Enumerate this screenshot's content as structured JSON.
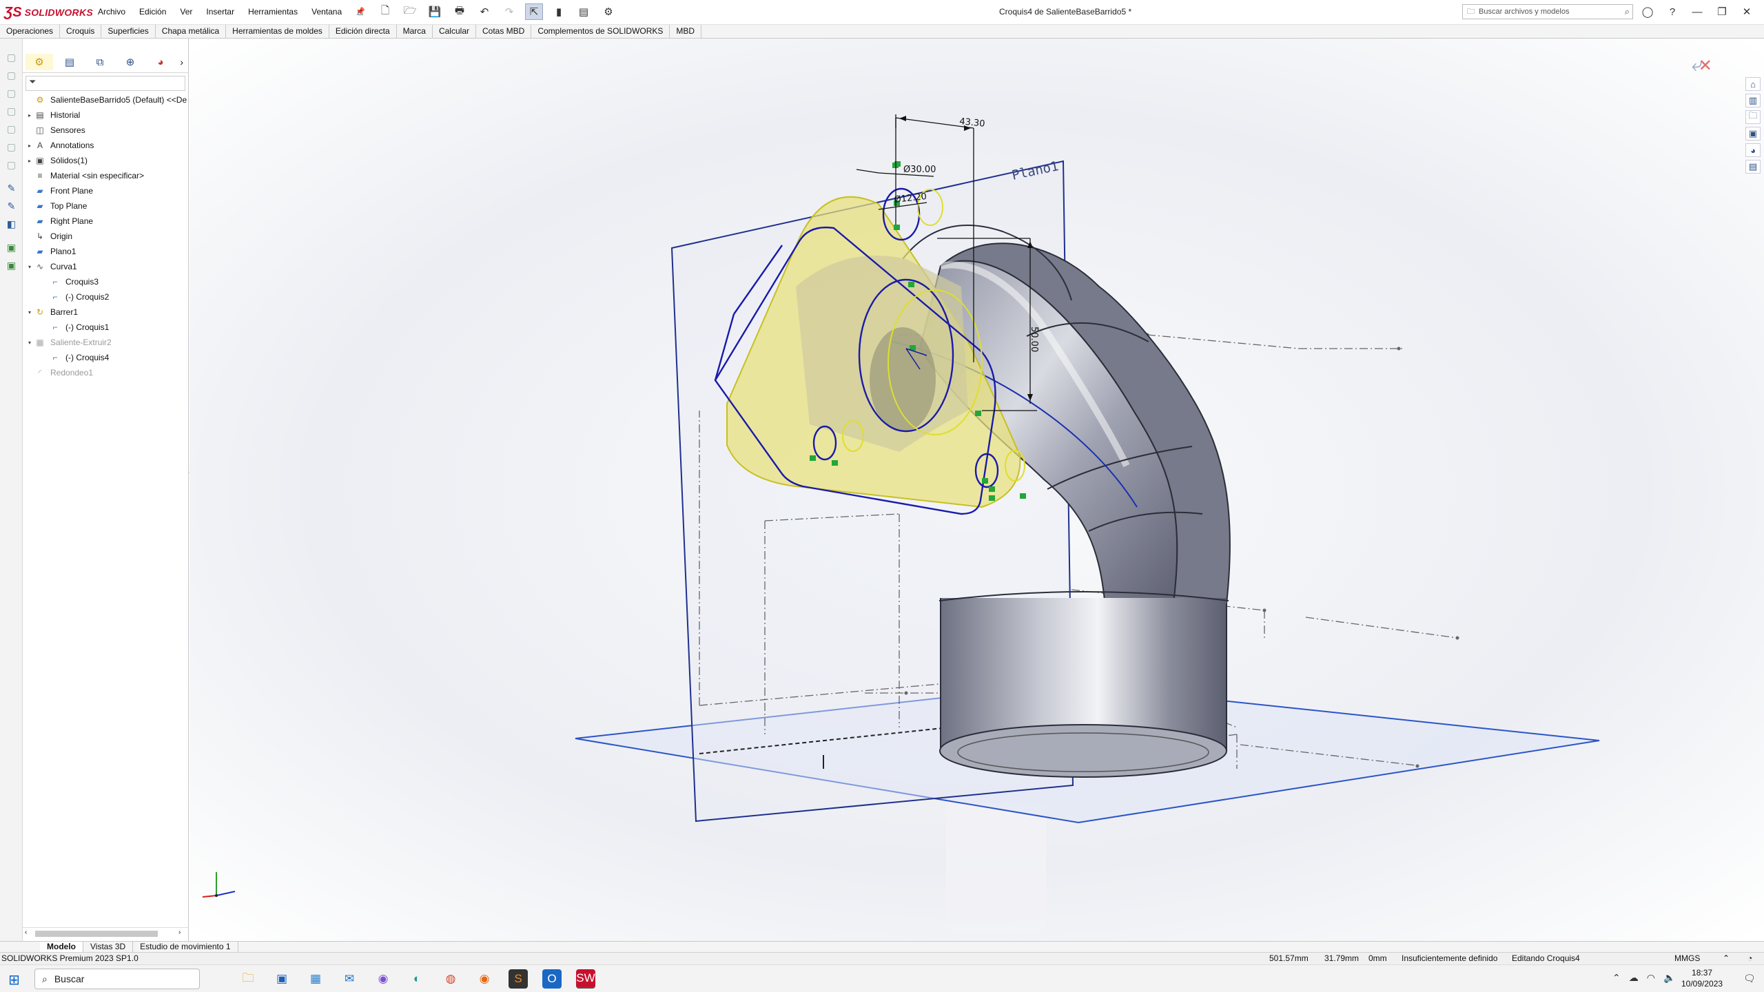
{
  "app": {
    "brand": "SOLIDWORKS",
    "document_title": "Croquis4 de SalienteBaseBarrido5 *"
  },
  "menu": {
    "items": [
      "Archivo",
      "Edición",
      "Ver",
      "Insertar",
      "Herramientas",
      "Ventana"
    ]
  },
  "search": {
    "placeholder": "Buscar archivos y modelos"
  },
  "command_tabs": [
    "Operaciones",
    "Croquis",
    "Superficies",
    "Chapa metálica",
    "Herramientas de moldes",
    "Edición directa",
    "Marca",
    "Calcular",
    "Cotas MBD",
    "Complementos de SOLIDWORKS",
    "MBD"
  ],
  "feature_tree": [
    {
      "label": "SalienteBaseBarrido5 (Default) <<De",
      "indent": 0,
      "expand": "",
      "icon": "part-icon"
    },
    {
      "label": "Historial",
      "indent": 0,
      "expand": "▸",
      "icon": "history-icon"
    },
    {
      "label": "Sensores",
      "indent": 0,
      "expand": "",
      "icon": "sensor-icon"
    },
    {
      "label": "Annotations",
      "indent": 0,
      "expand": "▸",
      "icon": "annotation-icon"
    },
    {
      "label": "Sólidos(1)",
      "indent": 0,
      "expand": "▸",
      "icon": "solid-bodies-icon"
    },
    {
      "label": "Material <sin especificar>",
      "indent": 0,
      "expand": "",
      "icon": "material-icon"
    },
    {
      "label": "Front Plane",
      "indent": 0,
      "expand": "",
      "icon": "plane-icon"
    },
    {
      "label": "Top Plane",
      "indent": 0,
      "expand": "",
      "icon": "plane-icon"
    },
    {
      "label": "Right Plane",
      "indent": 0,
      "expand": "",
      "icon": "plane-icon"
    },
    {
      "label": "Origin",
      "indent": 0,
      "expand": "",
      "icon": "origin-icon"
    },
    {
      "label": "Plano1",
      "indent": 0,
      "expand": "",
      "icon": "plane-icon"
    },
    {
      "label": "Curva1",
      "indent": 0,
      "expand": "▾",
      "icon": "curve-icon"
    },
    {
      "label": "Croquis3",
      "indent": 1,
      "expand": "",
      "icon": "sketch-icon"
    },
    {
      "label": "(-) Croquis2",
      "indent": 1,
      "expand": "",
      "icon": "sketch-icon"
    },
    {
      "label": "Barrer1",
      "indent": 0,
      "expand": "▾",
      "icon": "sweep-icon"
    },
    {
      "label": "(-) Croquis1",
      "indent": 1,
      "expand": "",
      "icon": "sketch-icon"
    },
    {
      "label": "Saliente-Extruir2",
      "indent": 0,
      "expand": "▾",
      "icon": "extrude-icon",
      "dim": true
    },
    {
      "label": "(-) Croquis4",
      "indent": 1,
      "expand": "",
      "icon": "sketch-icon"
    },
    {
      "label": "Redondeo1",
      "indent": 0,
      "expand": "",
      "icon": "fillet-icon",
      "dim": true
    }
  ],
  "viewport": {
    "plane_label": "Plano1",
    "dimensions": {
      "dim1": "43.30",
      "dim2": "Ø30.00",
      "dim3": "Ø12.20",
      "dim4": "50.00"
    },
    "colors": {
      "sketch": "#1a1aa8",
      "face": "#e8e07a",
      "tube": "#7d8090",
      "plane": "#2b54c6"
    }
  },
  "bottom_tabs": [
    "Modelo",
    "Vistas 3D",
    "Estudio de movimiento 1"
  ],
  "status": {
    "version": "SOLIDWORKS Premium 2023 SP1.0",
    "x": "501.57mm",
    "y": "31.79mm",
    "z": "0mm",
    "definition": "Insuficientemente definido",
    "editing": "Editando Croquis4",
    "units": "MMGS"
  },
  "taskbar": {
    "search_label": "Buscar",
    "time": "18:37",
    "date": "10/09/2023"
  }
}
